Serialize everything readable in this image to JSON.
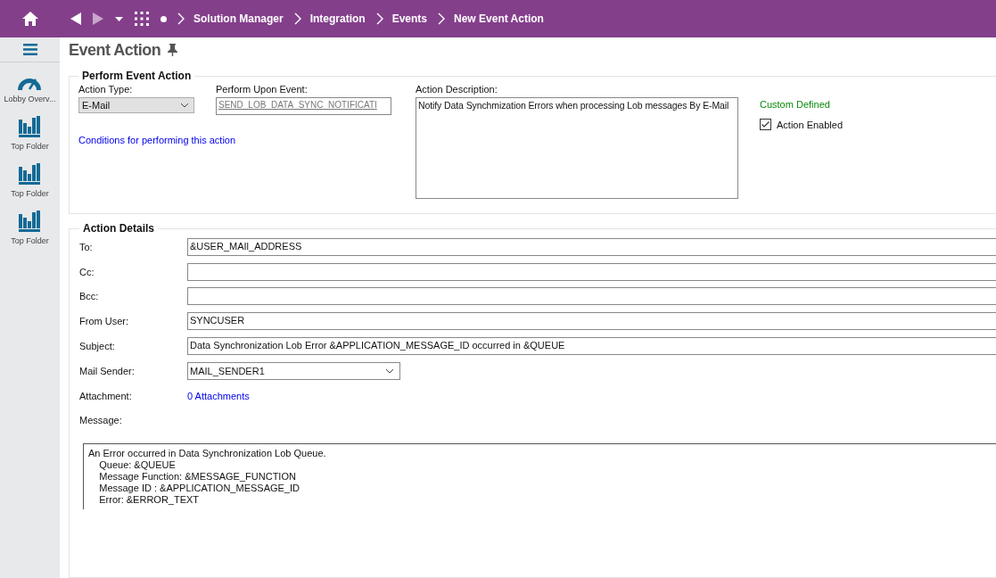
{
  "nav": {
    "breadcrumbs": [
      "Solution Manager",
      "Integration",
      "Events",
      "New Event Action"
    ]
  },
  "sidebar": {
    "items": [
      {
        "kind": "gauge",
        "label": "Lobby Overv..."
      },
      {
        "kind": "chart",
        "label": "Top Folder"
      },
      {
        "kind": "chart",
        "label": "Top Folder"
      },
      {
        "kind": "chart",
        "label": "Top Folder"
      }
    ]
  },
  "page": {
    "title": "Event Action"
  },
  "perform_group": {
    "title": "Perform Event Action",
    "action_type_label": "Action Type:",
    "action_type": "E-Mail",
    "event_label": "Perform Upon Event:",
    "event": "SEND_LOB_DATA_SYNC_NOTIFICATI",
    "conditions_link": "Conditions for performing this action",
    "description_label": "Action Description:",
    "description": "Notify Data Synchmization Errors when processing Lob messages By E-Mail",
    "custom_defined": "Custom Defined",
    "action_enabled": {
      "label": "Action Enabled",
      "checked": true
    }
  },
  "details_group": {
    "title": "Action Details",
    "fields": [
      {
        "kind": "text",
        "label": "To:",
        "value": "&USER_MAIl_ADDRESS"
      },
      {
        "kind": "text",
        "label": "Cc:"
      },
      {
        "kind": "text",
        "label": "Bcc:"
      },
      {
        "kind": "text",
        "label": "From User:",
        "value": "SYNCUSER"
      },
      {
        "kind": "text",
        "label": "Subject:",
        "value": "Data Synchronization Lob Error  &APPLICATION_MESSAGE_ID occurred in  &QUEUE"
      },
      {
        "kind": "select",
        "label": "Mail Sender:",
        "value": "MAIL_SENDER1"
      },
      {
        "kind": "link",
        "label": "Attachment:",
        "value": "0 Attachments"
      },
      {
        "kind": "label",
        "label": "Message:"
      }
    ],
    "message": "An Error occurred in Data Synchronization Lob Queue.\n    Queue: &QUEUE\n    Message Function: &MESSAGE_FUNCTION\n    Message ID : &APPLICATION_MESSAGE_ID\n    Error: &ERROR_TEXT"
  }
}
